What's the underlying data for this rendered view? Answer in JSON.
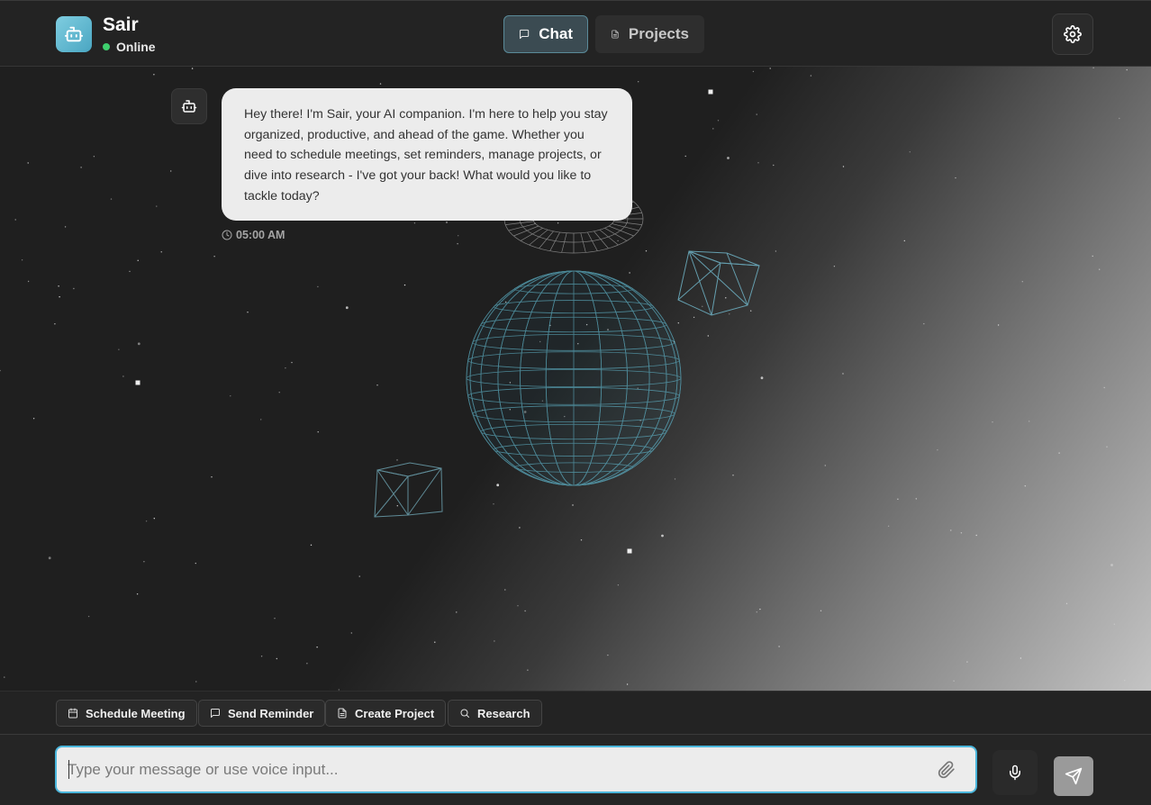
{
  "app": {
    "name": "Sair",
    "status": "Online",
    "status_color": "#3ecf6e",
    "logo_icon": "robot-icon",
    "accent": "#4ab6dc"
  },
  "tabs": [
    {
      "label": "Chat",
      "icon": "message-icon",
      "active": true
    },
    {
      "label": "Projects",
      "icon": "document-icon",
      "active": false
    }
  ],
  "header": {
    "settings_icon": "gear-icon"
  },
  "messages": [
    {
      "sender": "bot",
      "text": "Hey there! I'm Sair, your AI companion. I'm here to help you stay organized, productive, and ahead of the game. Whether you need to schedule meetings, set reminders, manage projects, or dive into research - I've got your back! What would you like to tackle today?",
      "time": "05:00 AM"
    }
  ],
  "quick_actions": [
    {
      "label": "Schedule Meeting",
      "icon": "calendar-icon"
    },
    {
      "label": "Send Reminder",
      "icon": "message-icon"
    },
    {
      "label": "Create Project",
      "icon": "document-icon"
    },
    {
      "label": "Research",
      "icon": "search-icon"
    }
  ],
  "composer": {
    "placeholder": "Type your message or use voice input...",
    "value": "",
    "attach_icon": "paperclip-icon",
    "mic_icon": "microphone-icon",
    "send_icon": "send-icon"
  }
}
